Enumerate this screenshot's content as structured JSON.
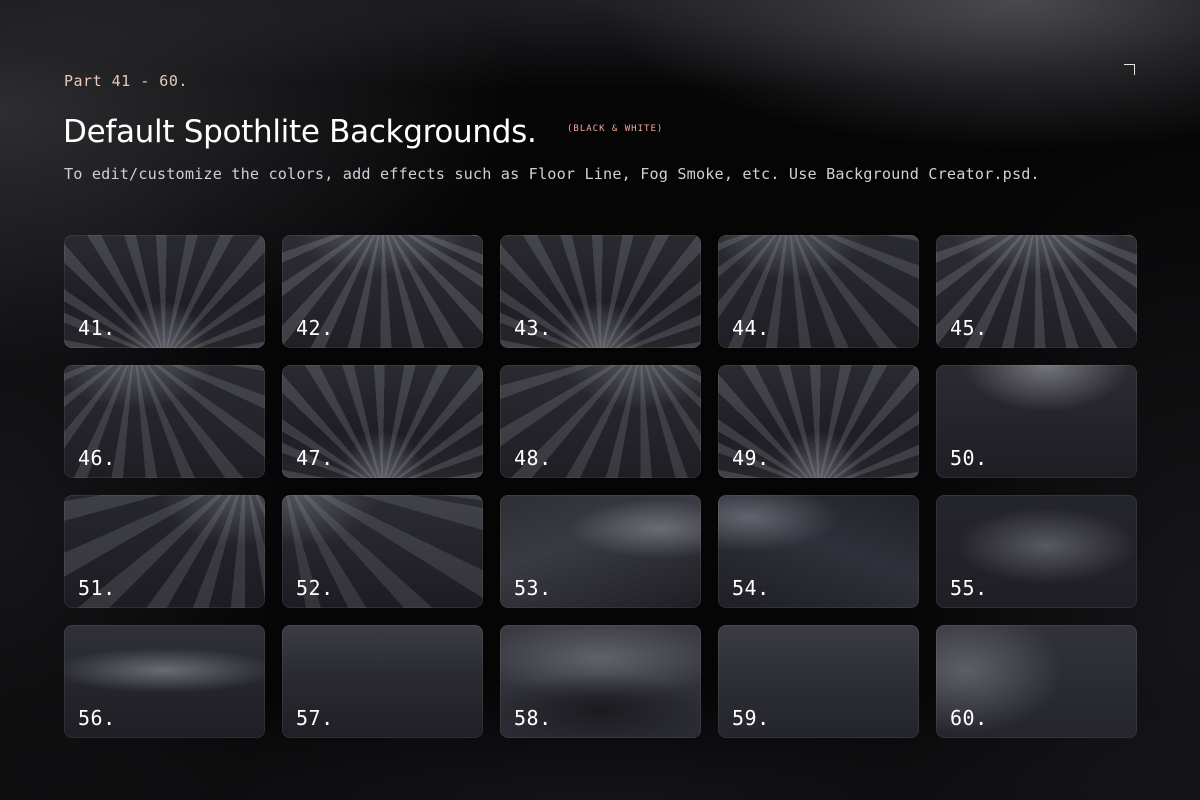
{
  "header": {
    "part_label": "Part 41 - 60.",
    "title": "Default Spothlite Backgrounds.",
    "title_tag": "(BLACK & WHITE)",
    "subtitle": "To edit/customize the colors, add effects such as Floor Line, Fog Smoke, etc. Use Background Creator.psd."
  },
  "colors": {
    "page_background": "#050506",
    "part_label": "#e8c9b8",
    "title_tag": "#f0a898",
    "title": "#ffffff",
    "subtitle": "#cfcfd4"
  },
  "tiles": [
    {
      "label": "41.",
      "style": "rays-up"
    },
    {
      "label": "42.",
      "style": "rays-down"
    },
    {
      "label": "43.",
      "style": "rays-up"
    },
    {
      "label": "44.",
      "style": "rays-down-left"
    },
    {
      "label": "45.",
      "style": "rays-down"
    },
    {
      "label": "46.",
      "style": "rays-down-left"
    },
    {
      "label": "47.",
      "style": "rays-up"
    },
    {
      "label": "48.",
      "style": "rays-down-right"
    },
    {
      "label": "49.",
      "style": "rays-up"
    },
    {
      "label": "50.",
      "style": "glow-top"
    },
    {
      "label": "51.",
      "style": "diag-right"
    },
    {
      "label": "52.",
      "style": "diag-left"
    },
    {
      "label": "53.",
      "style": "sweep-right"
    },
    {
      "label": "54.",
      "style": "sweep-left"
    },
    {
      "label": "55.",
      "style": "soft-center"
    },
    {
      "label": "56.",
      "style": "band-mid"
    },
    {
      "label": "57.",
      "style": "band-top"
    },
    {
      "label": "58.",
      "style": "band-arch"
    },
    {
      "label": "59.",
      "style": "band-soft"
    },
    {
      "label": "60.",
      "style": "glow-left"
    }
  ]
}
